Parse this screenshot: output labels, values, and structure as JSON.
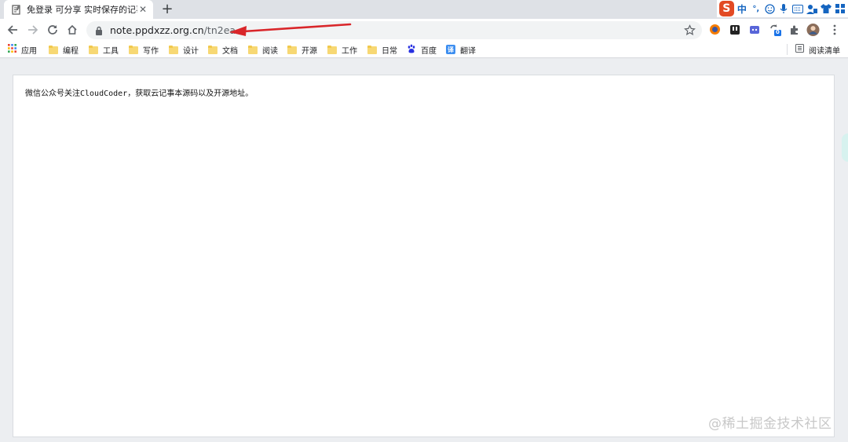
{
  "tab": {
    "title": "免登录 可分享 实时保存的记事本",
    "close_glyph": "✕",
    "new_tab_glyph": "+"
  },
  "ime": {
    "logo": "S",
    "mode": "中",
    "punct": "°,"
  },
  "omnibox": {
    "host": "note.ppdxzz.org.cn",
    "path": "/tn2ea"
  },
  "extension_badge": "0",
  "bookmarks": {
    "apps": "应用",
    "items": [
      "编程",
      "工具",
      "写作",
      "设计",
      "文档",
      "阅读",
      "开源",
      "工作",
      "日常"
    ],
    "baidu": "百度",
    "translate": "翻译",
    "translate_glyph": "译",
    "reading_list": "阅读清单"
  },
  "note": {
    "text": "微信公众号关注CloudCoder，获取云记事本源码以及开源地址。"
  },
  "watermark": "@稀土掘金技术社区",
  "colors": {
    "arrow": "#d9262a",
    "ime_logo": "#e24a24",
    "folder": "#f7d874"
  }
}
